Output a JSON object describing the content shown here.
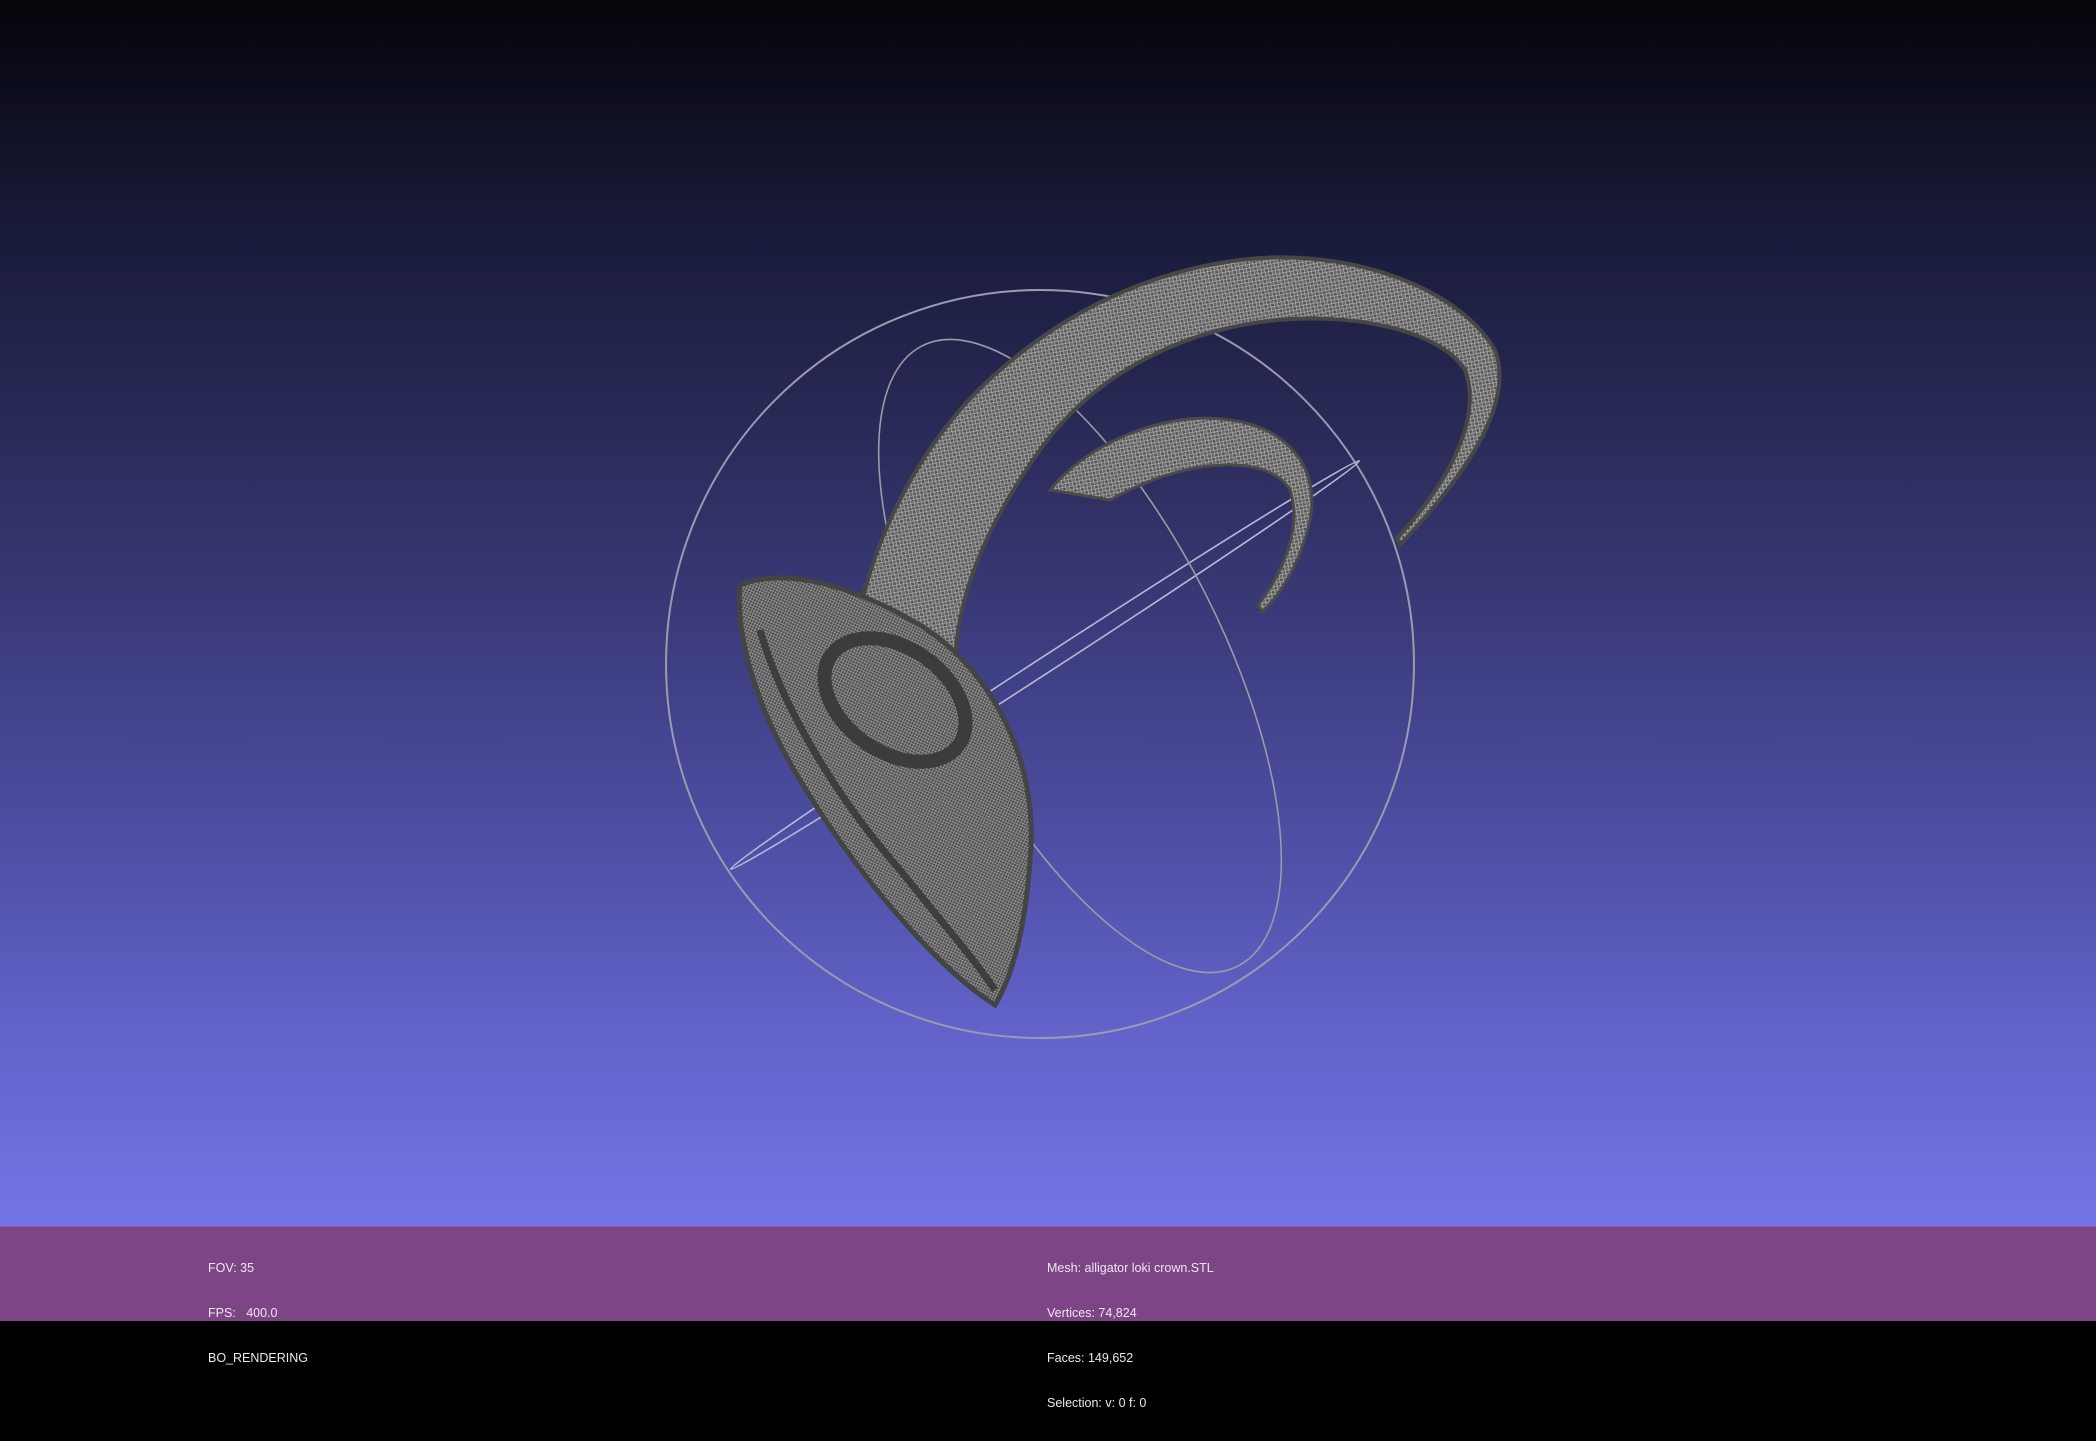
{
  "viewer_info": {
    "fov": "FOV: 35",
    "fps": "FPS:   400.0",
    "render_mode": "BO_RENDERING"
  },
  "mesh_info": {
    "mesh": "Mesh: alligator loki crown.STL",
    "vertices": "Vertices: 74,824",
    "faces": "Faces: 149,652",
    "selection": "Selection: v: 0 f: 0"
  },
  "colors": {
    "background_top": "#05050a",
    "background_bottom": "#7474e6",
    "info_bar": "#7d4585",
    "mesh": "#7a7a7a",
    "trackball_ring": "#9a9ab0",
    "trackball_green_ring": "#9fe8c8"
  },
  "icons": {
    "trackball": "trackball-gizmo",
    "mesh": "3d-mesh-model"
  }
}
